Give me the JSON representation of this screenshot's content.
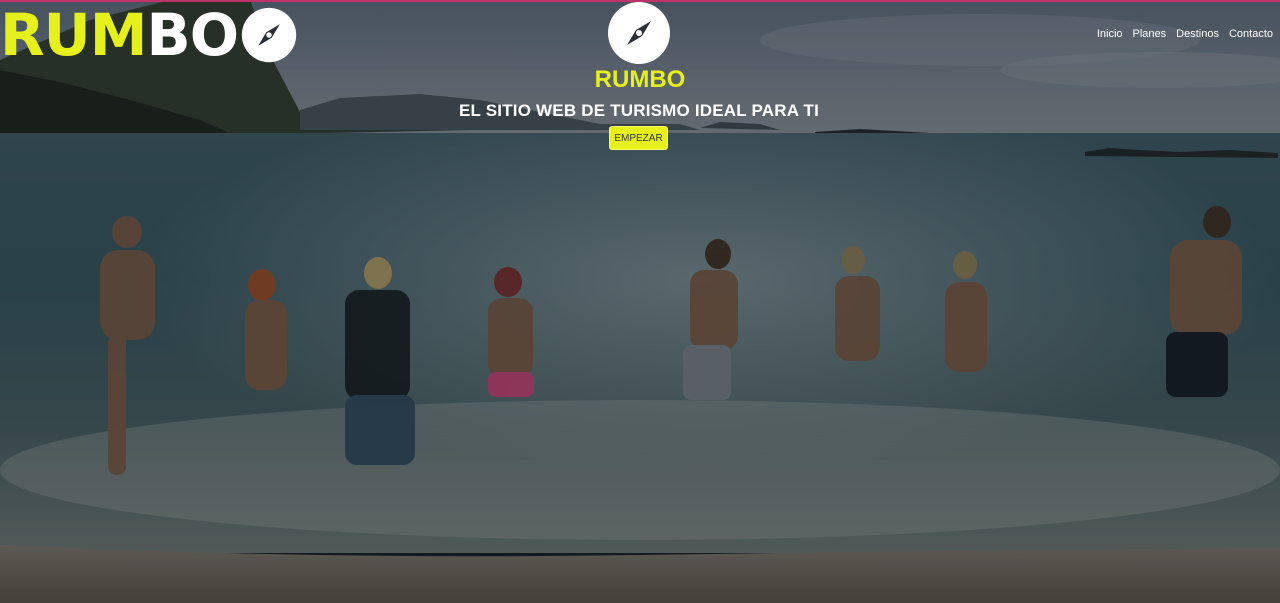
{
  "brand": {
    "logo_text": "RUMBO",
    "logo_rum": "RUM",
    "logo_bo": "BO",
    "center_title": "RUMBO",
    "accent_color": "#e6f01a",
    "icon": "compass-icon"
  },
  "nav": {
    "items": [
      {
        "label": "Inicio"
      },
      {
        "label": "Planes"
      },
      {
        "label": "Destinos"
      },
      {
        "label": "Contacto"
      }
    ]
  },
  "hero": {
    "subtitle": "EL SITIO WEB DE TURISMO IDEAL PARA TI",
    "cta_label": "EMPEZAR"
  }
}
